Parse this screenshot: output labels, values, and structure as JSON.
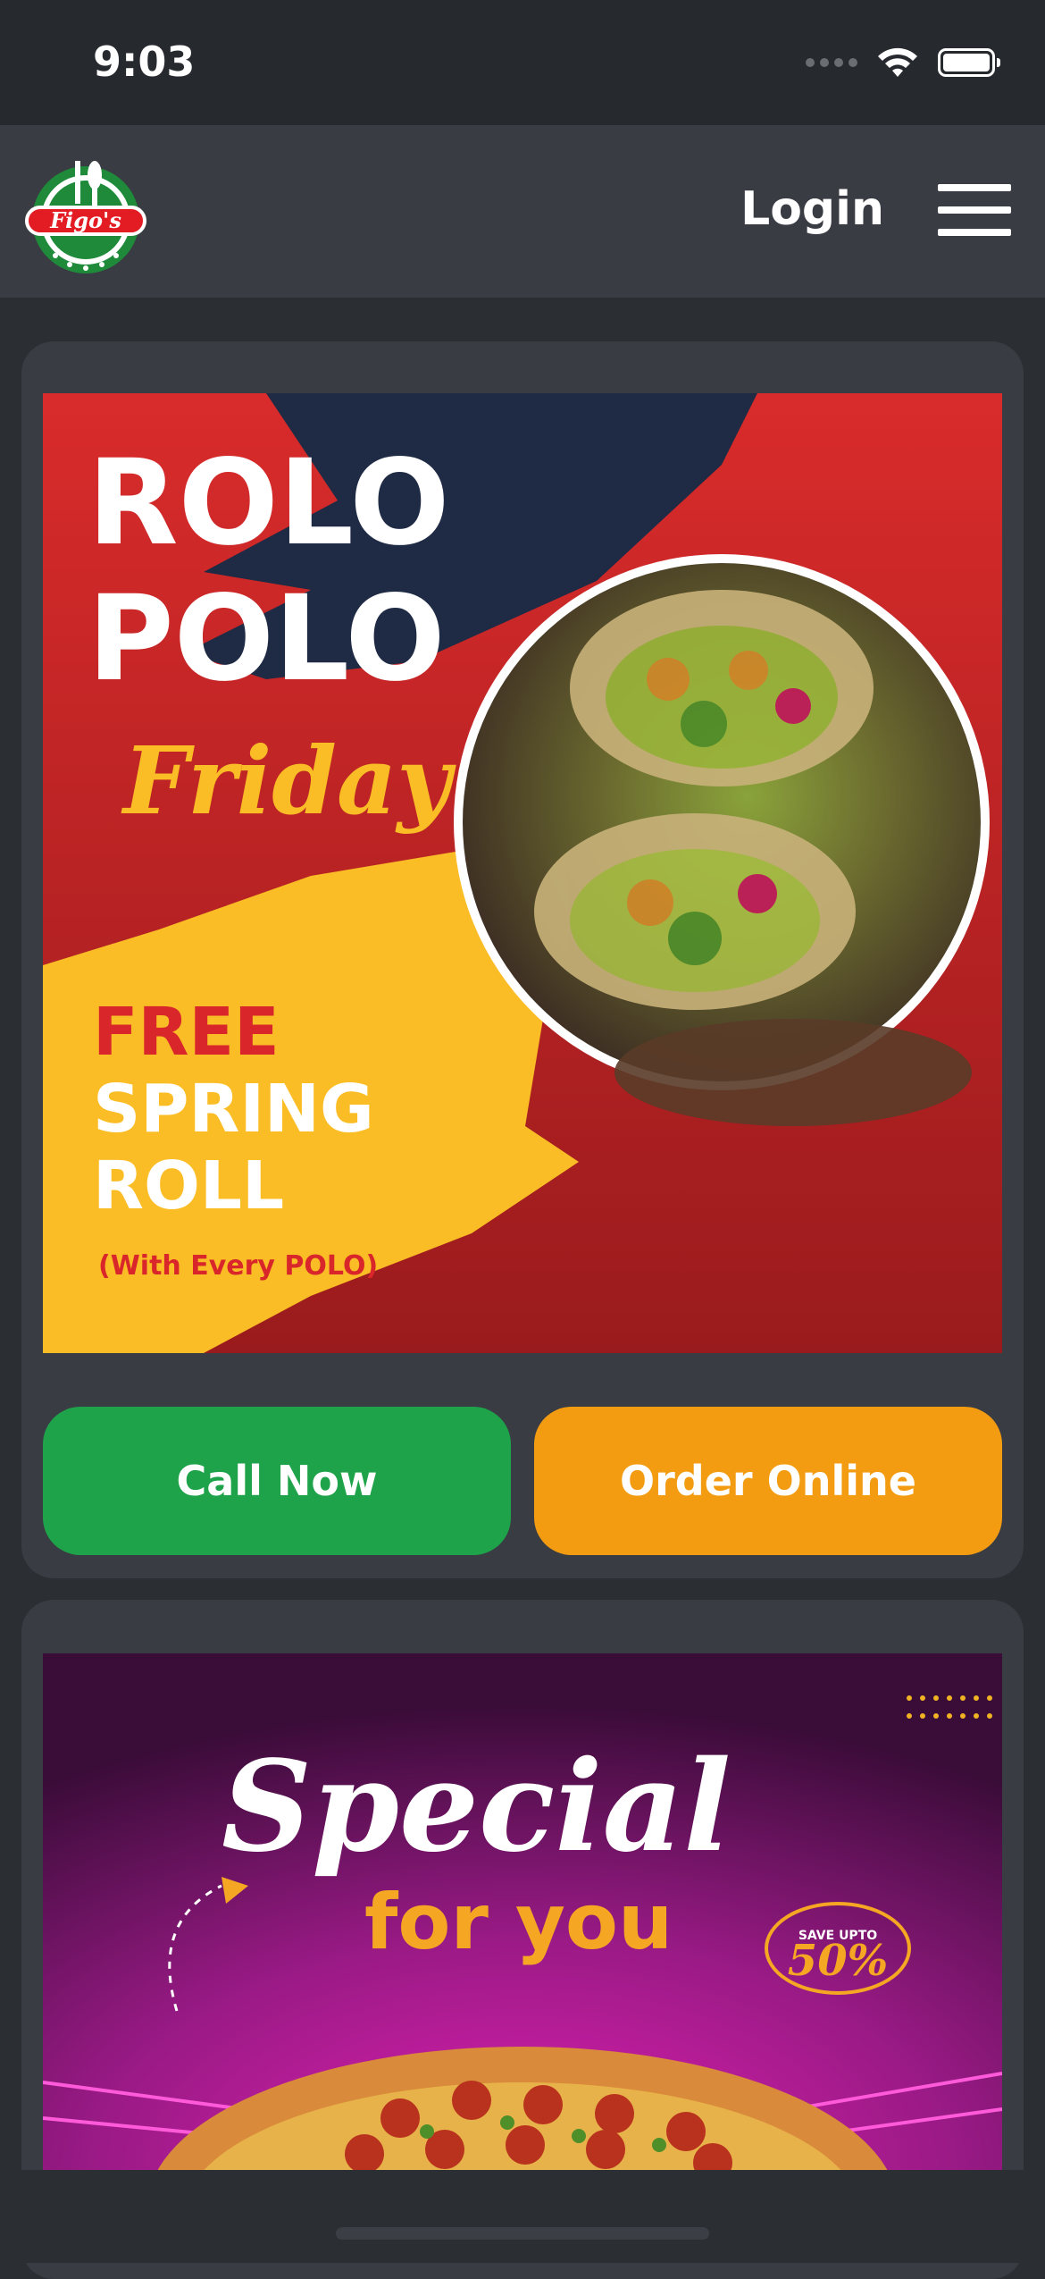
{
  "status_bar": {
    "time": "9:03"
  },
  "header": {
    "login_label": "Login",
    "logo_text": "Figo's"
  },
  "promo1": {
    "title_line1": "ROLO",
    "title_line2": "POLO",
    "day": "Friday",
    "offer_line1": "FREE",
    "offer_line2": "SPRING",
    "offer_line3": "ROLL",
    "offer_note": "(With Every POLO)"
  },
  "buttons": {
    "call": "Call Now",
    "order": "Order Online"
  },
  "promo2": {
    "headline": "Special",
    "subline": "for you",
    "badge_top": "SAVE UPTO",
    "badge_value": "50%"
  },
  "colors": {
    "call_green": "#1fa34a",
    "order_orange": "#f39c12",
    "promo_red": "#c1272d",
    "promo_yellow": "#fbbd26",
    "promo_navy": "#1f2a44",
    "special_magenta": "#8e1a7a"
  },
  "icons": [
    "wifi-icon",
    "battery-icon",
    "menu-icon",
    "logo-icon"
  ]
}
